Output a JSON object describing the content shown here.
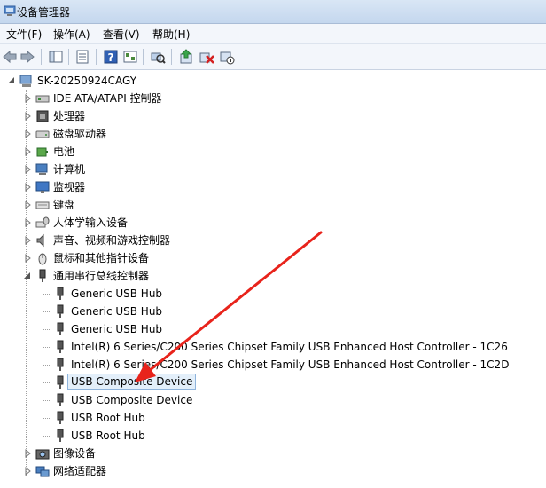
{
  "window": {
    "title": "设备管理器"
  },
  "menu": [
    {
      "label": "文件(F)"
    },
    {
      "label": "操作(A)"
    },
    {
      "label": "查看(V)"
    },
    {
      "label": "帮助(H)"
    }
  ],
  "toolbar": {
    "icons": [
      "back-icon",
      "forward-icon",
      "show-hide-tree-icon",
      "properties-icon",
      "help-icon",
      "resources-view-icon",
      "scan-hardware-icon",
      "update-driver-icon",
      "uninstall-icon",
      "disable-icon"
    ]
  },
  "tree": {
    "root": "SK-20250924CAGY",
    "categories": [
      {
        "label": "IDE ATA/ATAPI 控制器",
        "icon": "ide-controller-icon"
      },
      {
        "label": "处理器",
        "icon": "processor-icon"
      },
      {
        "label": "磁盘驱动器",
        "icon": "disk-drive-icon"
      },
      {
        "label": "电池",
        "icon": "battery-icon"
      },
      {
        "label": "计算机",
        "icon": "computer-icon"
      },
      {
        "label": "监视器",
        "icon": "monitor-icon"
      },
      {
        "label": "键盘",
        "icon": "keyboard-icon"
      },
      {
        "label": "人体学输入设备",
        "icon": "hid-icon"
      },
      {
        "label": "声音、视频和游戏控制器",
        "icon": "sound-icon"
      },
      {
        "label": "鼠标和其他指针设备",
        "icon": "mouse-icon"
      }
    ],
    "usb": {
      "label": "通用串行总线控制器",
      "children": [
        {
          "label": "Generic USB Hub"
        },
        {
          "label": "Generic USB Hub"
        },
        {
          "label": "Generic USB Hub"
        },
        {
          "label": "Intel(R) 6 Series/C200 Series Chipset Family USB Enhanced Host Controller - 1C26"
        },
        {
          "label": "Intel(R) 6 Series/C200 Series Chipset Family USB Enhanced Host Controller - 1C2D"
        },
        {
          "label": "USB Composite Device",
          "selected": true
        },
        {
          "label": "USB Composite Device"
        },
        {
          "label": "USB Root Hub"
        },
        {
          "label": "USB Root Hub"
        }
      ]
    },
    "after": [
      {
        "label": "图像设备",
        "icon": "imaging-icon"
      },
      {
        "label": "网络适配器",
        "icon": "network-adapter-icon"
      }
    ]
  },
  "annotation": {
    "arrow_color": "#e8231b"
  }
}
